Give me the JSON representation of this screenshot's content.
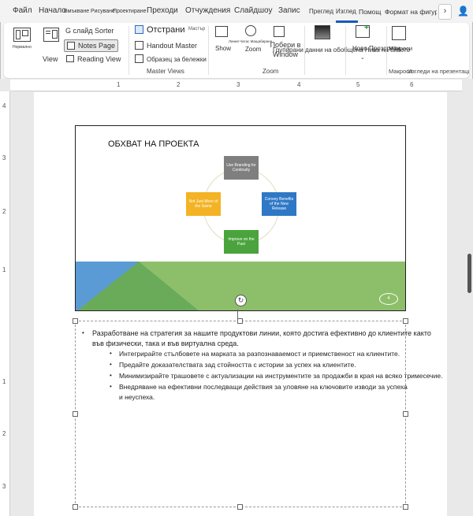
{
  "tabs": [
    {
      "label": "Файл"
    },
    {
      "label": "Начало"
    },
    {
      "label": "Вмъкване"
    },
    {
      "label": "Рисуване"
    },
    {
      "label": "Проектиране"
    },
    {
      "label": "Преходи"
    },
    {
      "label": "Отчуждения"
    },
    {
      "label": "Слайдшоу"
    },
    {
      "label": "Запис"
    },
    {
      "label": "Преглед"
    },
    {
      "label": "Изглед"
    },
    {
      "label": "Помощ"
    },
    {
      "label": "Формат на фигура"
    }
  ],
  "ribbon": {
    "normal": "Нормално",
    "view": "View",
    "sorter": "G слайд Sorter",
    "notes_page": "Notes Page",
    "reading_view": "Reading View",
    "master_views": {
      "slide_master": "Отстрани",
      "slide_master_small": "Мастър",
      "handout_master": "Handout Master",
      "notes_master": "Образец за бележки",
      "group_label": "Master Views"
    },
    "show": "Show",
    "zoom_small": "Линия Чатас Мащабиране",
    "zoom": "Zoom",
    "fit_to_window": "Побери в Window",
    "zoom_group_label": "Zoom",
    "color_grayscale": "Групирани данни на обобщена Нива на сивото",
    "new_window": "Ново",
    "window_label": "Прозорец",
    "switch_windows": "Ново Прозорети",
    "macros": "Макроси",
    "macros_group": "Макроси",
    "add_in_group": "Изгледи на презентация"
  },
  "ruler": {
    "top": [
      "1",
      "2",
      "3",
      "4",
      "5",
      "6"
    ],
    "left": [
      "4",
      "3",
      "2",
      "1",
      "1",
      "2",
      "3"
    ]
  },
  "slide": {
    "title": "ОБХВАТ НА ПРОЕКТА",
    "cards": [
      {
        "text": "Use Branding for Continuity",
        "color": "#7f7f7f"
      },
      {
        "text": "Convey Benefits of the New Release",
        "color": "#2e78c6"
      },
      {
        "text": "Improve on the Past",
        "color": "#4aa33c"
      },
      {
        "text": "Not Just More of the Same",
        "color": "#f3b324"
      }
    ],
    "slide_number": "4",
    "colors": {
      "blue": "#5b9bd5",
      "green": "#8dbf6a",
      "dark_green": "#6aab5a"
    }
  },
  "notes": {
    "main_bullet": "Разработване на стратегия за нашите продуктови линии, която достига ефективно до клиентите както във физически, така и във виртуална среда.",
    "main_bullet_line1": "Разработване на стратегия за нашите продуктови линии, която достига ефективно до клиентите както",
    "main_bullet_line2": "във физически, така и във виртуална среда.",
    "sub_bullets": [
      "Интегрирайте стълбовете на марката за разпознаваемост и приемственост на клиентите.",
      "Предайте доказателствата зад стойността с истории за успех на клиентите.",
      "Минимизирайте трашовете с актуализации на инструментите за продажби в края на всяко тримесечие.",
      "Внедряване на ефективни последващи действия за уловяне на ключовите изводи за успеха"
    ],
    "sub_bullet_last_line2": "и неуспеха."
  }
}
